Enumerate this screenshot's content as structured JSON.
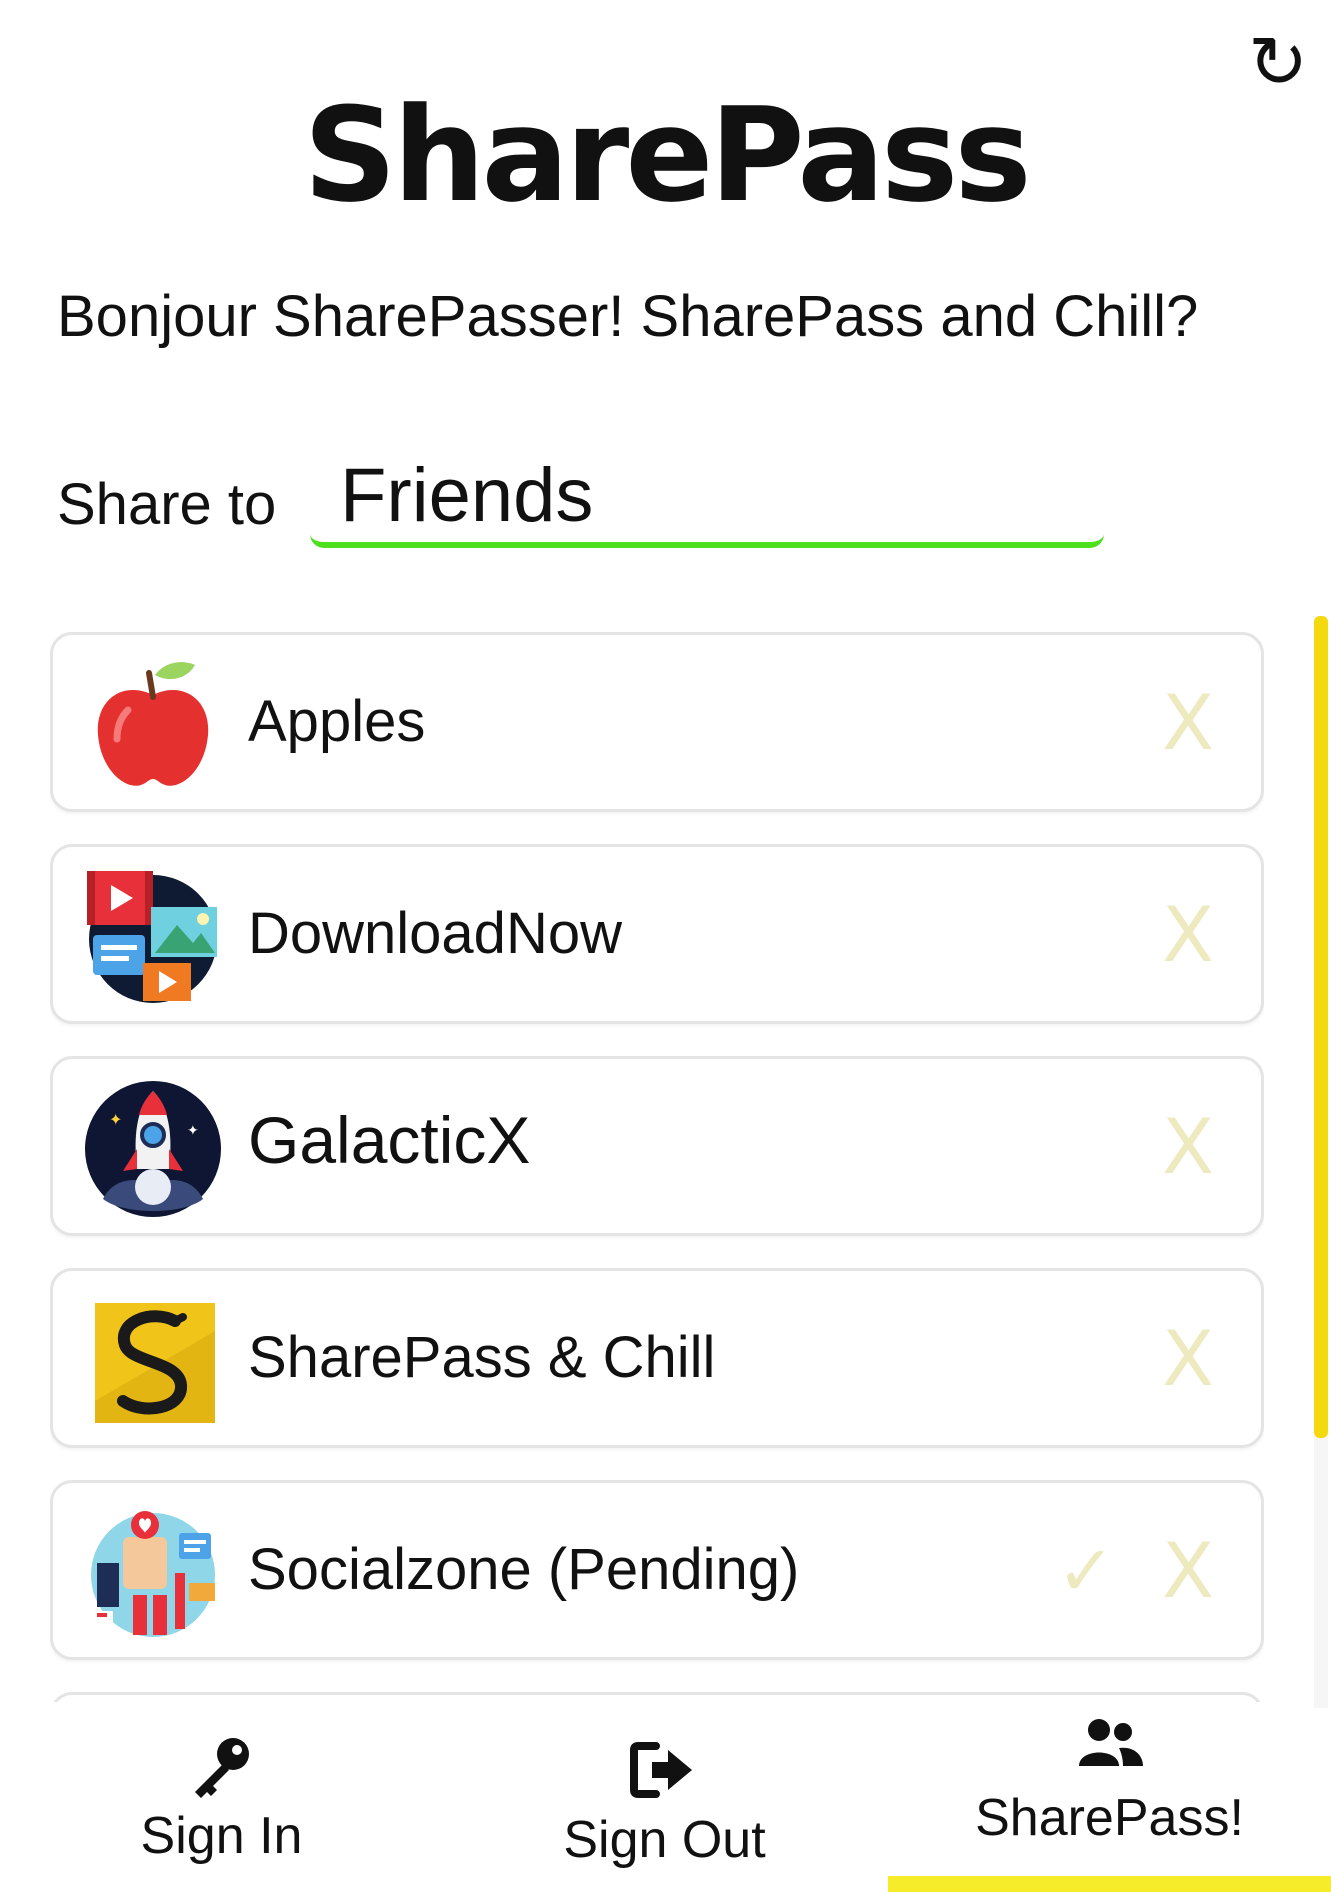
{
  "app": {
    "title": "SharePass",
    "refresh_icon": "refresh-icon"
  },
  "greeting": "Bonjour SharePasser! SharePass and Chill?",
  "share": {
    "label": "Share to",
    "value": "Friends",
    "underline_color": "#4ee01d"
  },
  "contacts": [
    {
      "name": "Apples",
      "icon": "apple-icon",
      "pending": false,
      "remove_label": "X"
    },
    {
      "name": "DownloadNow",
      "icon": "media-icon",
      "pending": false,
      "remove_label": "X"
    },
    {
      "name": "GalacticX",
      "icon": "rocket-icon",
      "pending": false,
      "remove_label": "X"
    },
    {
      "name": "SharePass & Chill",
      "icon": "sharepass-logo-icon",
      "pending": false,
      "remove_label": "X"
    },
    {
      "name": "Socialzone (Pending)",
      "icon": "social-icon",
      "pending": true,
      "accept_label": "✓",
      "remove_label": "X"
    }
  ],
  "nav": {
    "items": [
      {
        "label": "Sign In",
        "icon": "key-icon"
      },
      {
        "label": "Sign Out",
        "icon": "sign-out-icon"
      },
      {
        "label": "SharePass!",
        "icon": "users-icon",
        "active": true
      }
    ],
    "active_color": "#f7ec2a"
  },
  "colors": {
    "action_inactive": "#eeeac0",
    "scrollbar": "#f5d90f"
  }
}
